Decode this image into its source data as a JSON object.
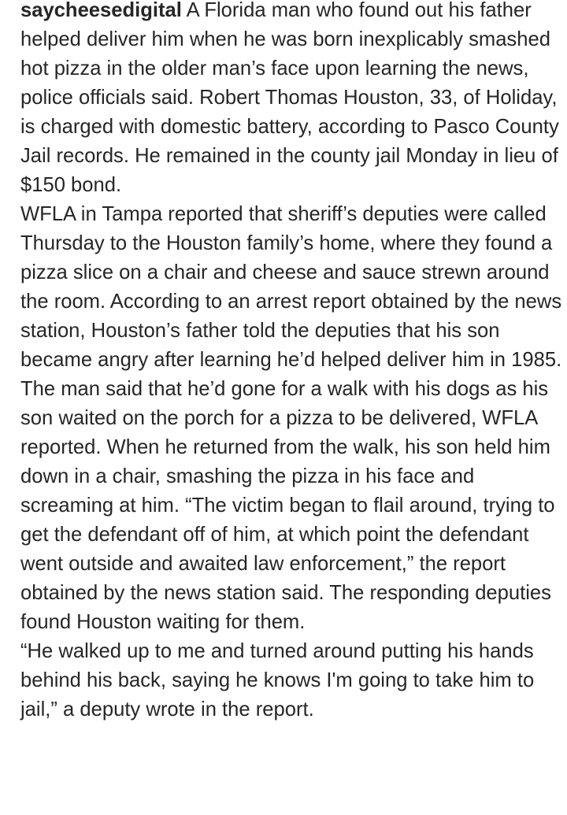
{
  "post": {
    "username": "saycheesedigital",
    "caption_paragraphs": [
      "A Florida man who found out his father helped deliver him when he was born inexplicably smashed hot pizza in the older man’s face upon learning the news, police officials said. Robert Thomas Houston, 33, of Holiday, is charged with domestic battery, according to Pasco County Jail records. He remained in the county jail Monday in lieu of $150 bond.",
      "WFLA in Tampa reported that sheriff’s deputies were called Thursday to the Houston family’s home, where they found a pizza slice on a chair and cheese and sauce strewn around the room. According to an arrest report obtained by the news station, Houston’s father told the deputies that his son became angry after learning he’d helped deliver him in 1985. The man said that he’d gone for a walk with his dogs as his son waited on the porch for a pizza to be delivered, WFLA reported. When he returned from the walk, his son held him down in a chair, smashing the pizza in his face and screaming at him. “The victim began to flail around, trying to get the defendant off of him, at which point the defendant went outside and awaited law enforcement,” the report obtained by the news station said. The responding deputies found Houston waiting for them.",
      "“He walked up to me and turned around putting his hands behind his back, saying he knows I'm going to take him to jail,” a deputy wrote in the report."
    ]
  }
}
